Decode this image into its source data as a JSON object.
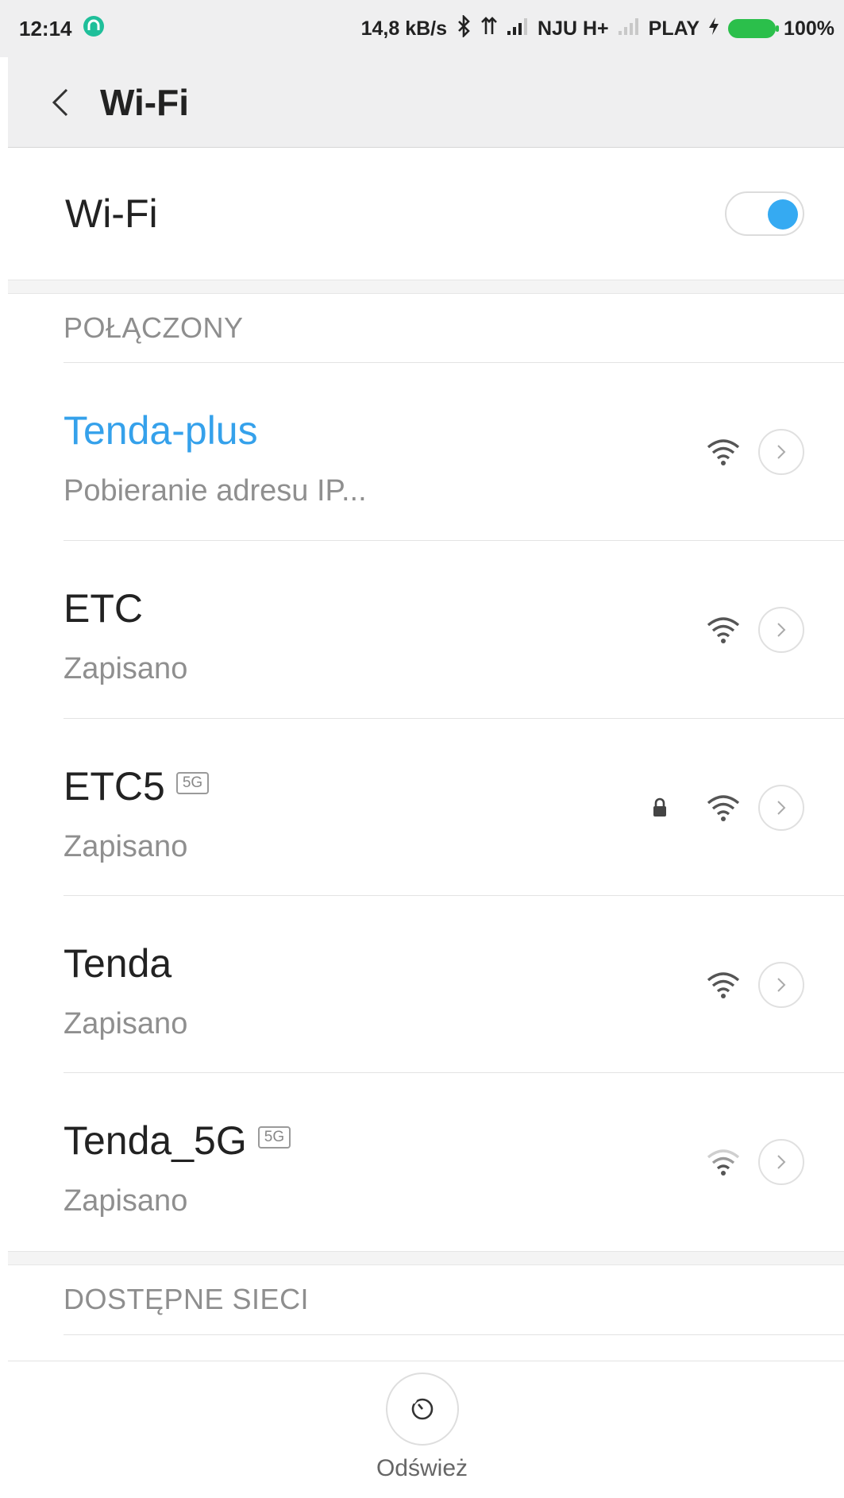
{
  "status_bar": {
    "time": "12:14",
    "speed": "14,8 kB/s",
    "carrier1": "NJU H+",
    "carrier2": "PLAY",
    "battery": "100%",
    "battery_color": "#2bbf4b"
  },
  "header": {
    "title": "Wi-Fi"
  },
  "wifi_toggle": {
    "label": "Wi-Fi",
    "state": "on",
    "accent": "#35aaf2"
  },
  "sections": {
    "connected_label": "POŁĄCZONY",
    "available_label": "DOSTĘPNE SIECI"
  },
  "networks": [
    {
      "name": "Tenda-plus",
      "status": "Pobieranie adresu IP...",
      "active": true,
      "band_tag": "",
      "locked": false,
      "signal_icon": "wifi-full-icon"
    },
    {
      "name": "ETC",
      "status": "Zapisano",
      "active": false,
      "band_tag": "",
      "locked": false,
      "signal_icon": "wifi-full-icon"
    },
    {
      "name": "ETC5",
      "status": "Zapisano",
      "active": false,
      "band_tag": "5G",
      "locked": true,
      "signal_icon": "wifi-full-icon"
    },
    {
      "name": "Tenda",
      "status": "Zapisano",
      "active": false,
      "band_tag": "",
      "locked": false,
      "signal_icon": "wifi-full-icon"
    },
    {
      "name": "Tenda_5G",
      "status": "Zapisano",
      "active": false,
      "band_tag": "5G",
      "locked": false,
      "signal_icon": "wifi-weak-icon"
    }
  ],
  "refresh": {
    "label": "Odśwież"
  }
}
